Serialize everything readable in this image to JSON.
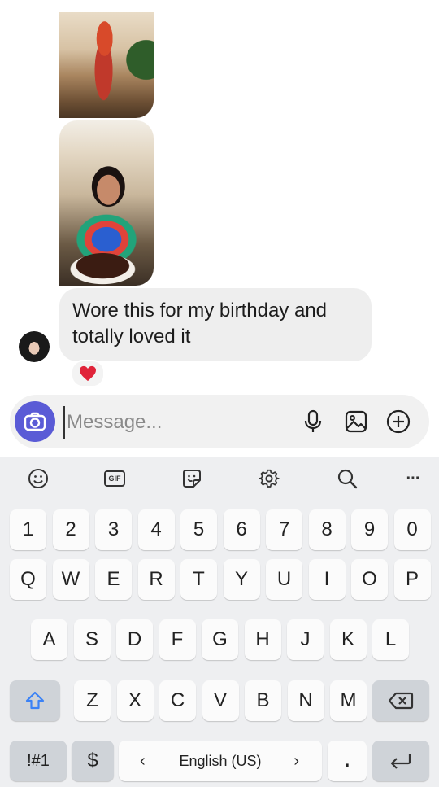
{
  "conversation": {
    "photos": [
      {
        "name": "outfit-photo"
      },
      {
        "name": "birthday-photo"
      }
    ],
    "message": {
      "text": "Wore this for my birthday and totally loved it",
      "reaction": "heart"
    }
  },
  "composer": {
    "placeholder": "Message...",
    "value": "",
    "icons": [
      "camera-icon",
      "microphone-icon",
      "image-icon",
      "add-icon"
    ]
  },
  "keyboard": {
    "toolbar": {
      "icons": [
        "emoji-icon",
        "gif-icon",
        "sticker-icon",
        "settings-icon",
        "search-icon",
        "more-icon"
      ],
      "gif_label": "GIF",
      "more_label": "···"
    },
    "number_row": [
      "1",
      "2",
      "3",
      "4",
      "5",
      "6",
      "7",
      "8",
      "9",
      "0"
    ],
    "row1": [
      "Q",
      "W",
      "E",
      "R",
      "T",
      "Y",
      "U",
      "I",
      "O",
      "P"
    ],
    "row2": [
      "A",
      "S",
      "D",
      "F",
      "G",
      "H",
      "J",
      "K",
      "L"
    ],
    "row3": [
      "Z",
      "X",
      "C",
      "V",
      "B",
      "N",
      "M"
    ],
    "bottom": {
      "symbols_label": "!#1",
      "currency_label": "$",
      "space_label": "English (US)",
      "prev_lang": "‹",
      "next_lang": "›",
      "period_label": "."
    }
  },
  "colors": {
    "accent": "#5a5bd6",
    "bubble": "#eeeeee",
    "keyboard_bg": "#eeeff1",
    "key": "#fbfbfb",
    "func_key": "#cfd3d8",
    "heart": "#e0243a",
    "shift_icon": "#3b82f6"
  }
}
